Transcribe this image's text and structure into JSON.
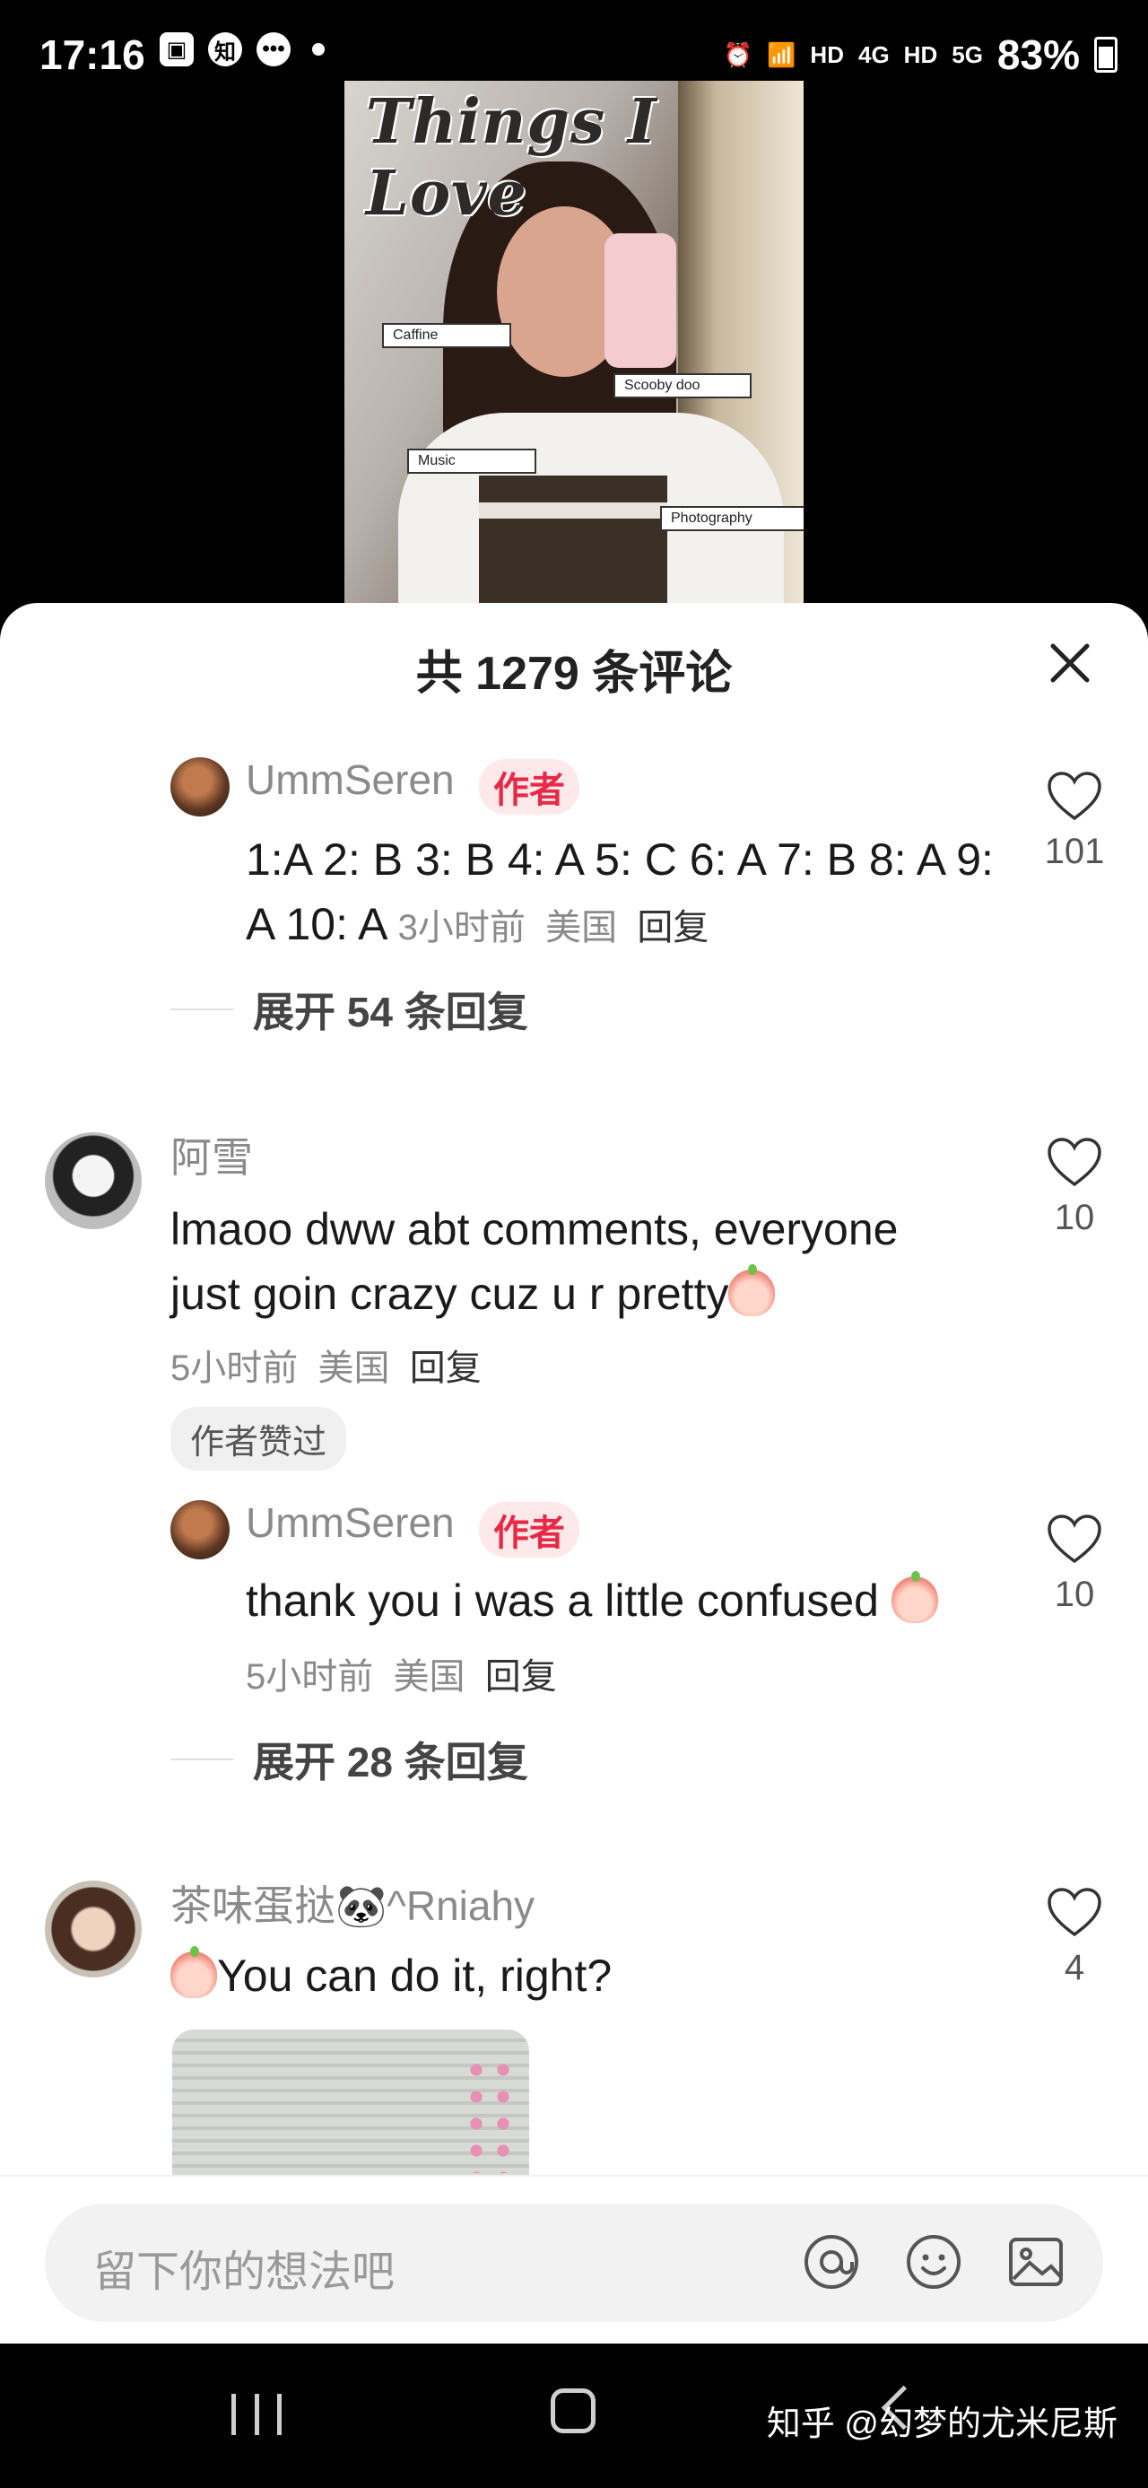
{
  "status_bar": {
    "time": "17:16",
    "left_icons": [
      "gallery-icon",
      "zhihu-icon",
      "chat-icon"
    ],
    "right_labels": [
      "HD",
      "4G",
      "HD",
      "5G"
    ],
    "battery": "83%"
  },
  "poster": {
    "title": "Things I Love",
    "tags": [
      "Caffine",
      "Scooby doo",
      "Music",
      "Photography"
    ]
  },
  "sheet": {
    "title": "共 1279 条评论"
  },
  "comments": [
    {
      "user": "UmmSeren",
      "badge": "作者",
      "text": "1:A 2: B 3: B 4: A 5: C 6: A 7: B 8: A 9: A 10: A",
      "time": "3小时前",
      "location": "美国",
      "reply": "回复",
      "likes": "101",
      "expand": "展开 54 条回复"
    },
    {
      "user": "阿雪",
      "text": "lmaoo dww abt comments, everyone just goin crazy cuz u r pretty",
      "time": "5小时前",
      "location": "美国",
      "reply": "回复",
      "likes": "10",
      "pill": "作者赞过",
      "sub": {
        "user": "UmmSeren",
        "badge": "作者",
        "text": "thank you i was a little confused",
        "time": "5小时前",
        "location": "美国",
        "reply": "回复",
        "likes": "10"
      },
      "expand": "展开 28 条回复"
    },
    {
      "user": "茶味蛋挞🐼^Rniahy",
      "text": "You can do it, right?",
      "likes": "4"
    }
  ],
  "input": {
    "placeholder": "留下你的想法吧"
  },
  "watermark": "知乎 @幻梦的尤米尼斯"
}
